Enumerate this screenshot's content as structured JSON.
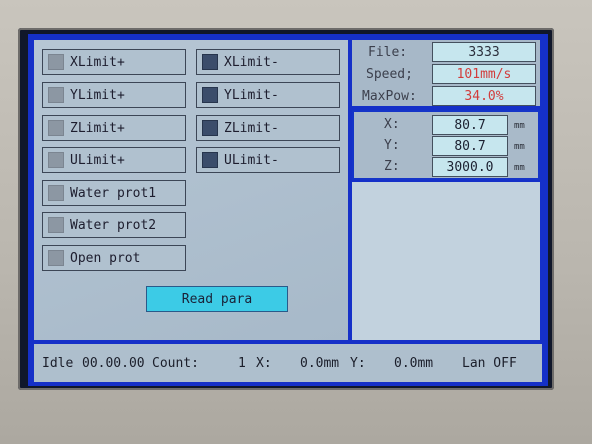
{
  "limit_buttons": [
    {
      "label": "XLimit+",
      "led": "off"
    },
    {
      "label": "XLimit-",
      "led": "on"
    },
    {
      "label": "YLimit+",
      "led": "off"
    },
    {
      "label": "YLimit-",
      "led": "on"
    },
    {
      "label": "ZLimit+",
      "led": "off"
    },
    {
      "label": "ZLimit-",
      "led": "on"
    },
    {
      "label": "ULimit+",
      "led": "off"
    },
    {
      "label": "ULimit-",
      "led": "on"
    },
    {
      "label": "Water prot1",
      "led": "off"
    },
    {
      "label": "Water prot2",
      "led": "off"
    },
    {
      "label": "Open prot",
      "led": "off"
    }
  ],
  "read_button": {
    "label": "Read para"
  },
  "file_info": {
    "file_label": "File:",
    "file_value": "3333",
    "speed_label": "Speed;",
    "speed_value": "101mm/s",
    "maxpow_label": "MaxPow:",
    "maxpow_value": "34.0%"
  },
  "position": {
    "x_label": "X:",
    "x_value": "80.7",
    "x_unit": "mm",
    "y_label": "Y:",
    "y_value": "80.7",
    "y_unit": "mm",
    "z_label": "Z:",
    "z_value": "3000.0",
    "z_unit": "mm"
  },
  "status": {
    "state": "Idle",
    "time": "00.00.00",
    "count_label": "Count:",
    "count_value": "1",
    "x_label": "X:",
    "x_value": "0.0mm",
    "y_label": "Y:",
    "y_value": "0.0mm",
    "lan": "Lan OFF"
  },
  "colors": {
    "lcd_border": "#1530c8",
    "value_box": "#c6e6ee",
    "speed_text": "#d23c3c",
    "read_button": "#3ccbe6"
  }
}
